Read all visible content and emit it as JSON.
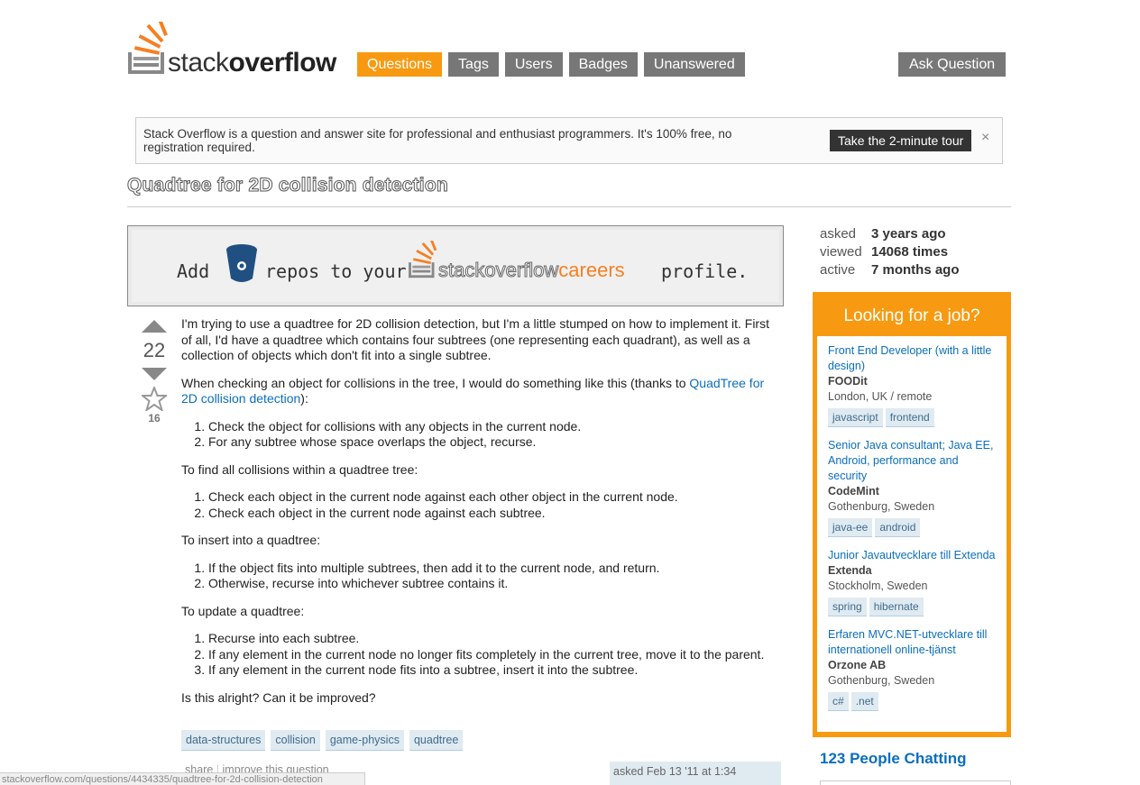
{
  "logo": {
    "word_light": "stack",
    "word_bold": "overflow"
  },
  "nav": [
    "Questions",
    "Tags",
    "Users",
    "Badges",
    "Unanswered"
  ],
  "nav_active": "Questions",
  "ask_question": "Ask Question",
  "notice": {
    "text": "Stack Overflow is a question and answer site for professional and enthusiast programmers. It's 100% free, no registration required.",
    "tour_button": "Take the 2-minute tour",
    "close": "×"
  },
  "question": {
    "title": "Quadtree for 2D collision detection",
    "votes": "22",
    "favorites": "16",
    "p1": "I'm trying to use a quadtree for 2D collision detection, but I'm a little stumped on how to implement it. First of all, I'd have a quadtree which contains four subtrees (one representing each quadrant), as well as a collection of objects which don't fit into a single subtree.",
    "p2_before": "When checking an object for collisions in the tree, I would do something like this (thanks to ",
    "p2_link": "QuadTree for 2D collision detection",
    "p2_after": "):",
    "list1": [
      "Check the object for collisions with any objects in the current node.",
      "For any subtree whose space overlaps the object, recurse."
    ],
    "p3": "To find all collisions within a quadtree tree:",
    "list2": [
      "Check each object in the current node against each other object in the current node.",
      "Check each object in the current node against each subtree."
    ],
    "p4": "To insert into a quadtree:",
    "list3": [
      "If the object fits into multiple subtrees, then add it to the current node, and return.",
      "Otherwise, recurse into whichever subtree contains it."
    ],
    "p5": "To update a quadtree:",
    "list4": [
      "Recurse into each subtree.",
      "If any element in the current node no longer fits completely in the current tree, move it to the parent.",
      "If any element in the current node fits into a subtree, insert it into the subtree."
    ],
    "p6": "Is this alright? Can it be improved?",
    "tags": [
      "data-structures",
      "collision",
      "game-physics",
      "quadtree"
    ],
    "menu_share": "share",
    "menu_sep": "|",
    "menu_improve": "improve this question",
    "asked_card": "asked Feb 13 '11 at 1:34"
  },
  "banner": {
    "add": "Add",
    "repos_to_your": "repos to your",
    "careers_so": "stackoverflow",
    "careers_word": "careers",
    "profile": "profile."
  },
  "stats": [
    {
      "label": "asked",
      "value": "3 years ago"
    },
    {
      "label": "viewed",
      "value": "14068 times"
    },
    {
      "label": "active",
      "value": "7 months ago"
    }
  ],
  "jobs": {
    "heading": "Looking for a job?",
    "items": [
      {
        "title": "Front End Developer (with a little design)",
        "company": "FOODit",
        "location": "London, UK / remote",
        "tags": [
          "javascript",
          "frontend"
        ]
      },
      {
        "title": "Senior Java consultant; Java EE, Android, performance and security",
        "company": "CodeMint",
        "location": "Gothenburg, Sweden",
        "tags": [
          "java-ee",
          "android"
        ]
      },
      {
        "title": "Junior Javautvecklare till Extenda",
        "company": "Extenda",
        "location": "Stockholm, Sweden",
        "tags": [
          "spring",
          "hibernate"
        ]
      },
      {
        "title": "Erfaren MVC.NET-utvecklare till internationell online-tjänst",
        "company": "Orzone AB",
        "location": "Gothenburg, Sweden",
        "tags": [
          "c#",
          ".net"
        ]
      }
    ]
  },
  "chat": "123 People Chatting",
  "status_url": "stackoverflow.com/questions/4434335/quadtree-for-2d-collision-detection",
  "colors": {
    "accent": "#f79a11",
    "nav_gray": "#777777",
    "link": "#0a6ebd",
    "tag_bg": "#e0eaf1"
  }
}
